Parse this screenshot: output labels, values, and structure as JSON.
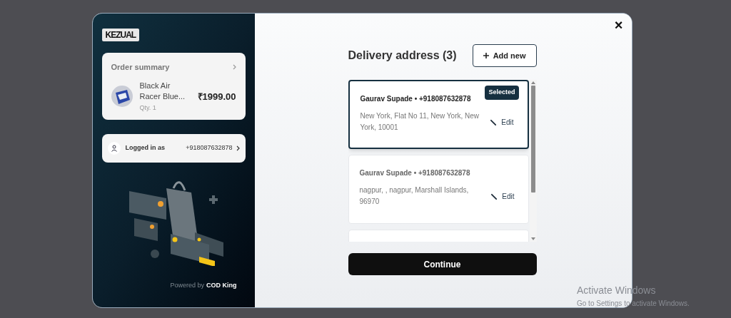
{
  "sidebar": {
    "logo": "KEZUAL",
    "order_summary": {
      "title": "Order summary",
      "product": "Black Air Racer Blue...",
      "quantity": "Qty. 1",
      "price": "₹1999.00"
    },
    "login": {
      "label": "Logged in as",
      "phone": "+918087632878"
    },
    "footer": {
      "prefix": "Powered by",
      "brand": "COD King"
    }
  },
  "main": {
    "close": "×",
    "title": "Delivery address (3)",
    "add_button": "Add new",
    "addresses": [
      {
        "name": "Gaurav Supade • +918087632878",
        "address": "New York, Flat No 11, New York, New York, 10001",
        "edit": "Edit",
        "selected": true,
        "badge": "Selected"
      },
      {
        "name": "Gaurav Supade • +918087632878",
        "address": "nagpur, , nagpur, Marshall Islands, 96970",
        "edit": "Edit",
        "selected": false
      },
      {
        "selected": false
      }
    ],
    "continue": "Continue"
  },
  "os_notice": {
    "title": "Activate Windows",
    "message": "Go to Settings to activate Windows."
  }
}
